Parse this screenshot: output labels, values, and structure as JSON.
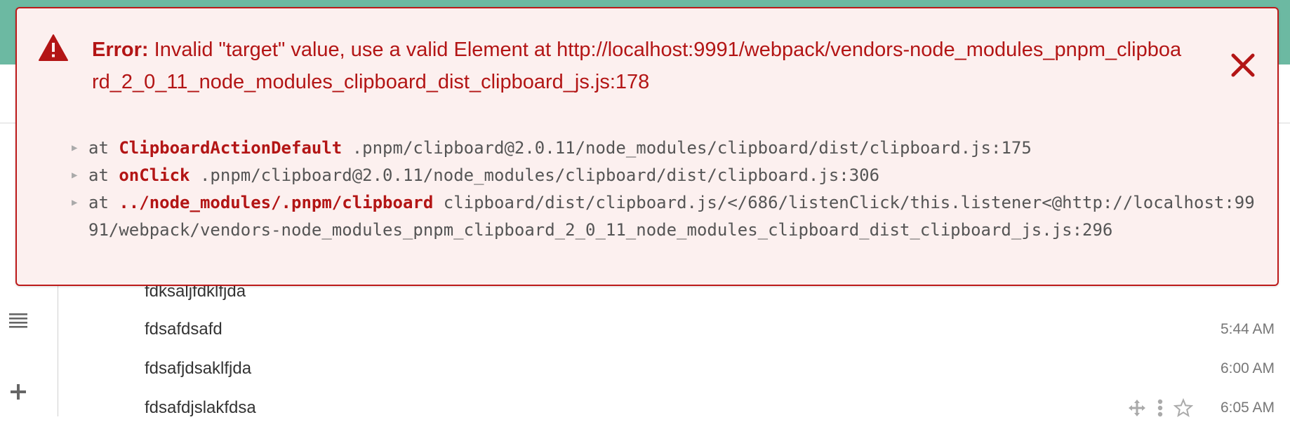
{
  "error": {
    "label": "Error:",
    "message": "Invalid \"target\" value, use a valid Element at http://localhost:9991/webpack/vendors-node_modules_pnpm_clipboard_2_0_11_node_modules_clipboard_dist_clipboard_js.js:178",
    "close_icon": "close-icon",
    "warning_icon": "warning-icon",
    "stack": [
      {
        "at": "at",
        "prefix": "",
        "function": "ClipboardActionDefault",
        "location": ".pnpm/clipboard@2.0.11/node_modules/clipboard/dist/clipboard.js:175"
      },
      {
        "at": "at",
        "prefix": "",
        "function": "onClick",
        "location": ".pnpm/clipboard@2.0.11/node_modules/clipboard/dist/clipboard.js:306"
      },
      {
        "at": "at",
        "prefix": "../node_modules/",
        "function": ".pnpm/clipboard",
        "location": "clipboard/dist/clipboard.js/</686/listenClick/this.listener<@http://localhost:9991/webpack/vendors-node_modules_pnpm_clipboard_2_0_11_node_modules_clipboard_dist_clipboard_js.js:296"
      }
    ]
  },
  "sidebar": {
    "icons": [
      "list-icon",
      "plus-icon"
    ]
  },
  "messages": [
    {
      "text": "fdksaljfdklfjda",
      "time": ""
    },
    {
      "text": "fdsafdsafd",
      "time": "5:44 AM"
    },
    {
      "text": "fdsafjdsaklfjda",
      "time": "6:00 AM"
    },
    {
      "text": "fdsafdjslakfdsa",
      "time": "6:05 AM"
    }
  ],
  "colors": {
    "error": "#b31515",
    "banner_bg": "#fcf0ef",
    "header": "#6cb9a2"
  }
}
